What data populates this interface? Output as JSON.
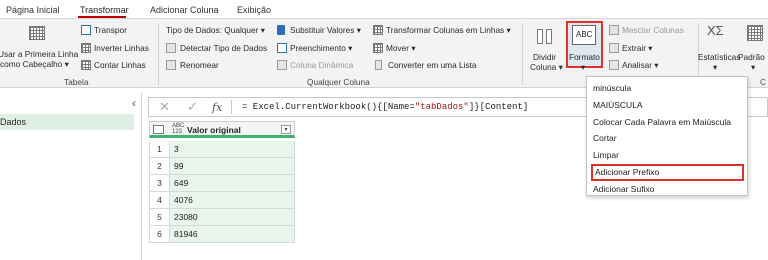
{
  "tabs": [
    {
      "label": "Página Inicial",
      "active": false
    },
    {
      "label": "Transformar",
      "active": true
    },
    {
      "label": "Adicionar Coluna",
      "active": false
    },
    {
      "label": "Exibição",
      "active": false
    }
  ],
  "ribbon": {
    "tabela": {
      "use_first_row_line1": "Usar a Primeira Linha",
      "use_first_row_line2": "como Cabeçalho ▾",
      "transpor": "Transpor",
      "inverter_linhas": "Inverter Linhas",
      "contar_linhas": "Contar Linhas",
      "group_label": "Tabela"
    },
    "qualquer_coluna": {
      "tipo_dados": "Tipo de Dados: Qualquer ▾",
      "detectar_tipo": "Detectar Tipo de Dados",
      "renomear": "Renomear",
      "substituir_valores": "Substituir Valores ▾",
      "preenchimento": "Preenchimento ▾",
      "coluna_dinamica": "Coluna Dinâmica",
      "transformar_colunas": "Transformar Colunas em Linhas ▾",
      "mover": "Mover ▾",
      "converter_lista": "Converter em uma Lista",
      "group_label": "Qualquer Coluna"
    },
    "texto": {
      "dividir_line1": "Dividir",
      "dividir_line2": "Coluna ▾",
      "formato": "Formato",
      "formato_caret": "▾",
      "mesclar_colunas": "Mesclar Colunas",
      "extrair": "Extrair ▾",
      "analisar": "Analisar ▾",
      "formato_icon_text": "ABC"
    },
    "numero": {
      "estatisticas": "Estatísticas",
      "estatisticas_caret": "▾",
      "padrao": "Padrão",
      "padrao_caret": "▾",
      "sigma": "XΣ",
      "group_label_partial": "C"
    }
  },
  "left_pane": {
    "collapse": "‹",
    "query": "Dados"
  },
  "formula_bar": {
    "cancel": "✕",
    "confirm": "✓",
    "fx": "fx",
    "formula_prefix": "= Excel.CurrentWorkbook(){[Name=",
    "formula_string": "\"tabDados\"",
    "formula_suffix": "]}[Content]"
  },
  "grid": {
    "type_icon_line1": "ABC",
    "type_icon_line2": "123",
    "column_header": "Valor original",
    "dropdown_caret": "▾",
    "rows": [
      {
        "n": "1",
        "v": "3"
      },
      {
        "n": "2",
        "v": "99"
      },
      {
        "n": "3",
        "v": "649"
      },
      {
        "n": "4",
        "v": "4076"
      },
      {
        "n": "5",
        "v": "23080"
      },
      {
        "n": "6",
        "v": "81946"
      }
    ]
  },
  "format_menu": {
    "items": [
      "minúscula",
      "MAIÚSCULA",
      "Colocar Cada Palavra em Maiúscula",
      "Cortar",
      "Limpar",
      "Adicionar Prefixo",
      "Adicionar Sufixo"
    ],
    "highlighted_index": 5
  },
  "colors": {
    "accent_red": "#e0302a",
    "selection_green": "#e8f5ec",
    "header_green": "#3cb371"
  }
}
